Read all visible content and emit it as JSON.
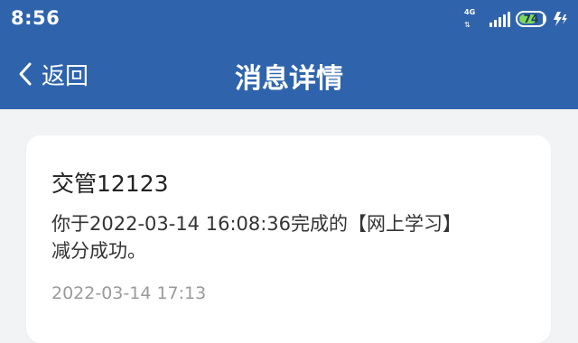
{
  "status_bar": {
    "time": "8:56",
    "network_label": "4G",
    "battery_level": "74",
    "battery_fraction": 0.74,
    "colors": {
      "bar_background": "#2f64ad",
      "battery_fill": "#7ed957"
    }
  },
  "nav": {
    "back_label": "返回",
    "title": "消息详情",
    "icons": {
      "back": "chevron-left-icon"
    }
  },
  "message": {
    "sender": "交管12123",
    "body_line1": "你于2022-03-14 16:08:36完成的【网上学习】",
    "body_line2": "减分成功。",
    "timestamp": "2022-03-14 17:13"
  }
}
